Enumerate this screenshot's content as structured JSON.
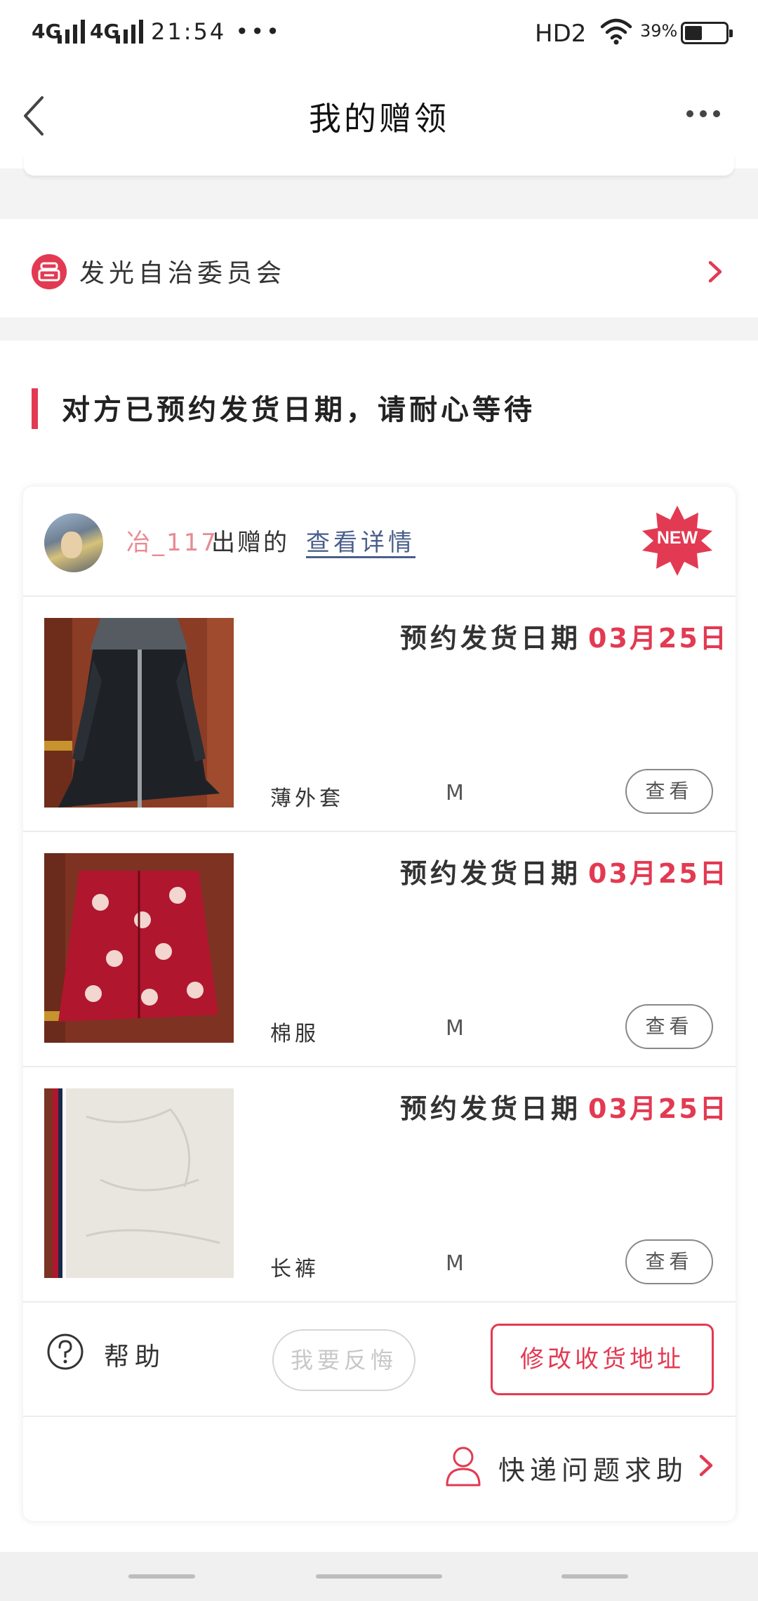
{
  "status_bar": {
    "network1": "4G",
    "network2": "4G",
    "time": "21:54",
    "dots": "•••",
    "hd": "HD2",
    "battery": "39%"
  },
  "nav": {
    "title": "我的赠领"
  },
  "committee": {
    "label": "发光自治委员会"
  },
  "status": {
    "message": "对方已预约发货日期，请耐心等待"
  },
  "order": {
    "donor": "冶_117",
    "donated_text": "出赠的",
    "view_detail": "查看详情",
    "badge": "NEW",
    "items": [
      {
        "date_label": "预约发货日期",
        "date": "03月25日",
        "name": "薄外套",
        "size": "M",
        "view": "查看"
      },
      {
        "date_label": "预约发货日期",
        "date": "03月25日",
        "name": "棉服",
        "size": "M",
        "view": "查看"
      },
      {
        "date_label": "预约发货日期",
        "date": "03月25日",
        "name": "长裤",
        "size": "M",
        "view": "查看"
      }
    ],
    "help": "帮助",
    "regret": "我要反悔",
    "change_address": "修改收货地址",
    "express_help": "快递问题求助"
  }
}
